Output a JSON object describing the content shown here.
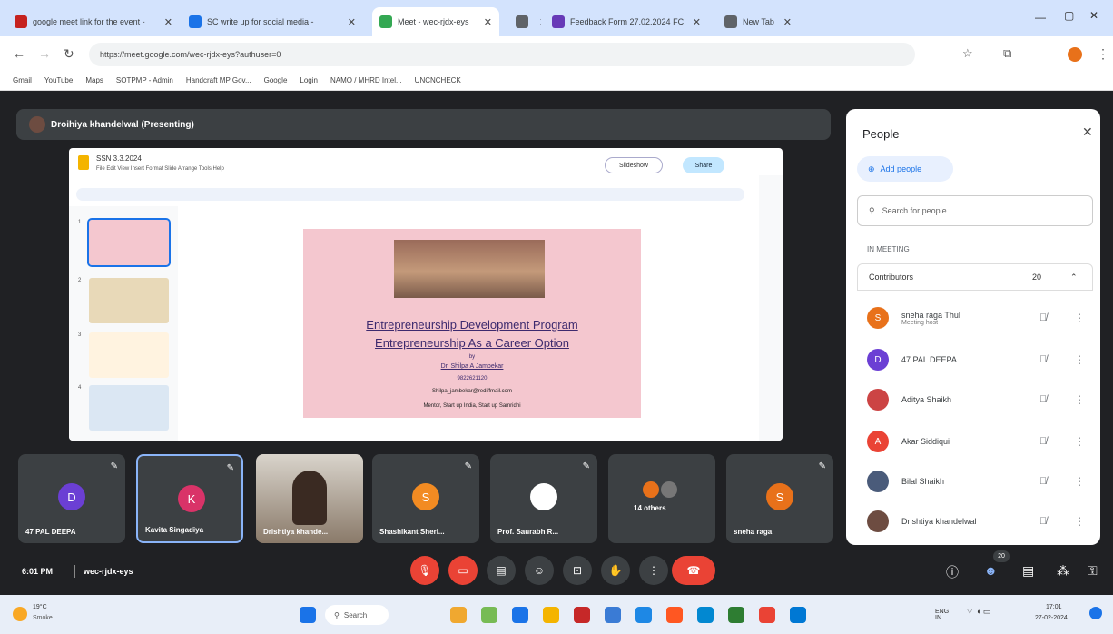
{
  "browser": {
    "tabs": [
      {
        "label": "google meet link for the event - ",
        "color": "#c5221f"
      },
      {
        "label": "SC write up for social media - ",
        "color": "#1a73e8"
      },
      {
        "label": "Meet - wec-rjdx-eys",
        "color": "#34a853",
        "active": true
      },
      {
        "label": "",
        "color": "#5f6368"
      },
      {
        "label": "Feedback Form 27.02.2024 FC",
        "color": "#673ab7"
      },
      {
        "label": "New Tab",
        "color": "#5f6368"
      }
    ],
    "url": "https://meet.google.com/wec-rjdx-eys?authuser=0",
    "bookmarks": [
      "Gmail",
      "YouTube",
      "Maps",
      "SOTPMP - Admin",
      "Handcraft MP Gov...",
      "Google",
      "Login",
      "NAMO / MHRD Intel...",
      "UNCNCHECK"
    ]
  },
  "meet": {
    "presenter": "Droihiya khandelwal (Presenting)",
    "slides_app": {
      "doc_title": "SSN 3.3.2024",
      "menu": "File  Edit  View  Insert  Format  Slide  Arrange  Tools  Help",
      "slideshow_label": "Slideshow",
      "share_label": "Share"
    },
    "slide": {
      "title1": "Entrepreneurship Development Program",
      "title2": "Entrepreneurship As a Career Option",
      "by": "by",
      "author": "Dr. Shilpa A Jambekar",
      "phone": "9822621120",
      "email": "Shilpa_jambekar@rediffmail.com",
      "footer": "Mentor, Start up India, Start up Samridhi"
    },
    "thumb_numbers": [
      "1",
      "2",
      "3",
      "4"
    ],
    "participants_tiles": [
      {
        "initial": "D",
        "name": "47 PAL DEEPA",
        "color": "#6b3fd4"
      },
      {
        "initial": "K",
        "name": "Kavita Singadiya",
        "color": "#d93368"
      },
      {
        "initial": "",
        "name": "Drishtiya khande...",
        "color": ""
      },
      {
        "initial": "S",
        "name": "Shashikant Sheri...",
        "color": "#f28b22"
      },
      {
        "initial": "",
        "name": "Prof. Saurabh R...",
        "color": ""
      },
      {
        "initial": "",
        "name": "14 others",
        "color": ""
      },
      {
        "initial": "S",
        "name": "sneha raga",
        "color": "#e8711a"
      }
    ],
    "bottom": {
      "time": "6:01 PM",
      "code": "wec-rjdx-eys",
      "participant_count": "20"
    }
  },
  "people_panel": {
    "title": "People",
    "add_people": "Add people",
    "search_placeholder": "Search for people",
    "section": "IN MEETING",
    "contributors_label": "Contributors",
    "contributors_count": "20",
    "people": [
      {
        "name": "sneha raga Thul",
        "sub": "Meeting host",
        "initial": "S",
        "color": "#e8711a"
      },
      {
        "name": "47 PAL DEEPA",
        "sub": "",
        "initial": "D",
        "color": "#6b3fd4"
      },
      {
        "name": "Aditya Shaikh",
        "sub": "",
        "initial": "",
        "color": "#c44"
      },
      {
        "name": "Akar Siddiqui",
        "sub": "",
        "initial": "A",
        "color": "#ea4335"
      },
      {
        "name": "Bilal Shaikh",
        "sub": "",
        "initial": "",
        "color": "#4a5b7a"
      },
      {
        "name": "Drishtiya khandelwal",
        "sub": "",
        "initial": "",
        "color": "#6d4c41"
      }
    ]
  },
  "taskbar": {
    "weather_temp": "19°C",
    "weather_desc": "Smoke",
    "search": "Search",
    "lang": "ENG IN",
    "time": "17:01",
    "date": "27-02-2024"
  }
}
